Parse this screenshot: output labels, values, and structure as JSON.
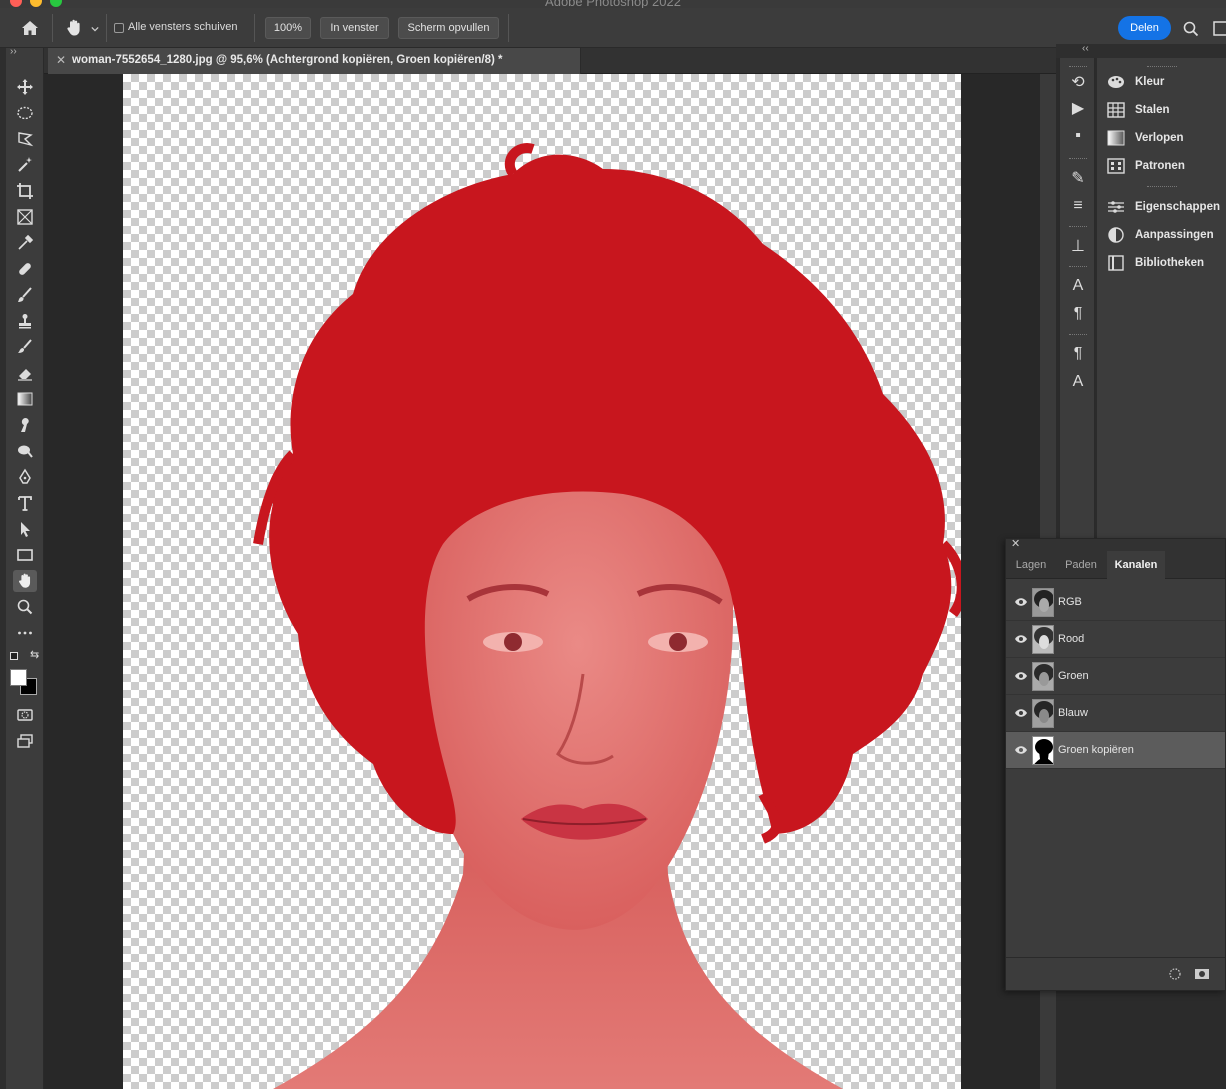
{
  "app": {
    "title": "Adobe Photoshop 2022"
  },
  "options_bar": {
    "checkbox_label": "Alle vensters schuiven",
    "zoom_button": "100%",
    "fit_button": "In venster",
    "fill_button": "Scherm opvullen",
    "share_button": "Delen"
  },
  "document": {
    "tab_label": "woman-7552654_1280.jpg @ 95,6% (Achtergrond kopiëren, Groen kopiëren/8) *"
  },
  "right_panels": {
    "items": [
      {
        "label": "Kleur",
        "icon": "palette-icon"
      },
      {
        "label": "Stalen",
        "icon": "swatches-icon"
      },
      {
        "label": "Verlopen",
        "icon": "gradient-icon"
      },
      {
        "label": "Patronen",
        "icon": "patterns-icon"
      },
      {
        "label": "Eigenschappen",
        "icon": "properties-icon"
      },
      {
        "label": "Aanpassingen",
        "icon": "adjustments-icon"
      },
      {
        "label": "Bibliotheken",
        "icon": "libraries-icon"
      }
    ]
  },
  "channels_panel": {
    "tabs": [
      "Lagen",
      "Paden",
      "Kanalen"
    ],
    "active_tab": "Kanalen",
    "channels": [
      {
        "name": "RGB"
      },
      {
        "name": "Rood"
      },
      {
        "name": "Groen"
      },
      {
        "name": "Blauw"
      },
      {
        "name": "Groen kopiëren"
      }
    ],
    "selected_channel": "Groen kopiëren"
  },
  "colors": {
    "accent": "#1473e6",
    "quick_mask_red": "#c8161e",
    "skin_tint": "#e07a78"
  }
}
